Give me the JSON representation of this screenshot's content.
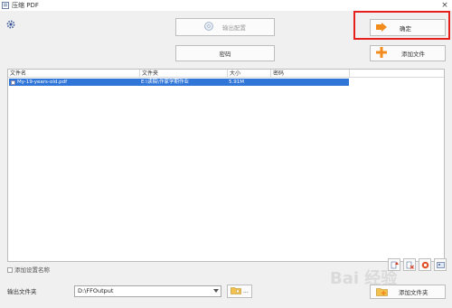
{
  "window": {
    "title": "压缩 PDF",
    "close_glyph": "×"
  },
  "icons": {
    "app": "pdf-app-icon",
    "settings": "gear-icon",
    "output_config": "disc-icon",
    "confirm": "arrow-right-icon",
    "add_file": "plus-icon",
    "browse": "folder-icon"
  },
  "colors": {
    "selection": "#3075d8",
    "highlight_box": "#e51e1e",
    "orange_accent": "#f28c1c"
  },
  "toolbar": {
    "output_config_label": "输出配置",
    "password_label": "密码",
    "confirm_label": "确定",
    "add_file_label": "添加文件",
    "add_folder_label": "添加文件夹"
  },
  "table": {
    "headers": [
      "文件名",
      "文件夹",
      "大小",
      "密码"
    ],
    "rows": [
      {
        "name": "My-19-years-old.pdf",
        "folder": "E:\\读稿\\作家学期作业",
        "size": "5.91M",
        "password": ""
      }
    ]
  },
  "options": {
    "add_setting_name_label": "添加设置名称"
  },
  "output": {
    "label": "输出文件夹",
    "path": "D:\\FFOutput",
    "browse_text": "..."
  },
  "watermark": {
    "text": "Bai 经验"
  }
}
